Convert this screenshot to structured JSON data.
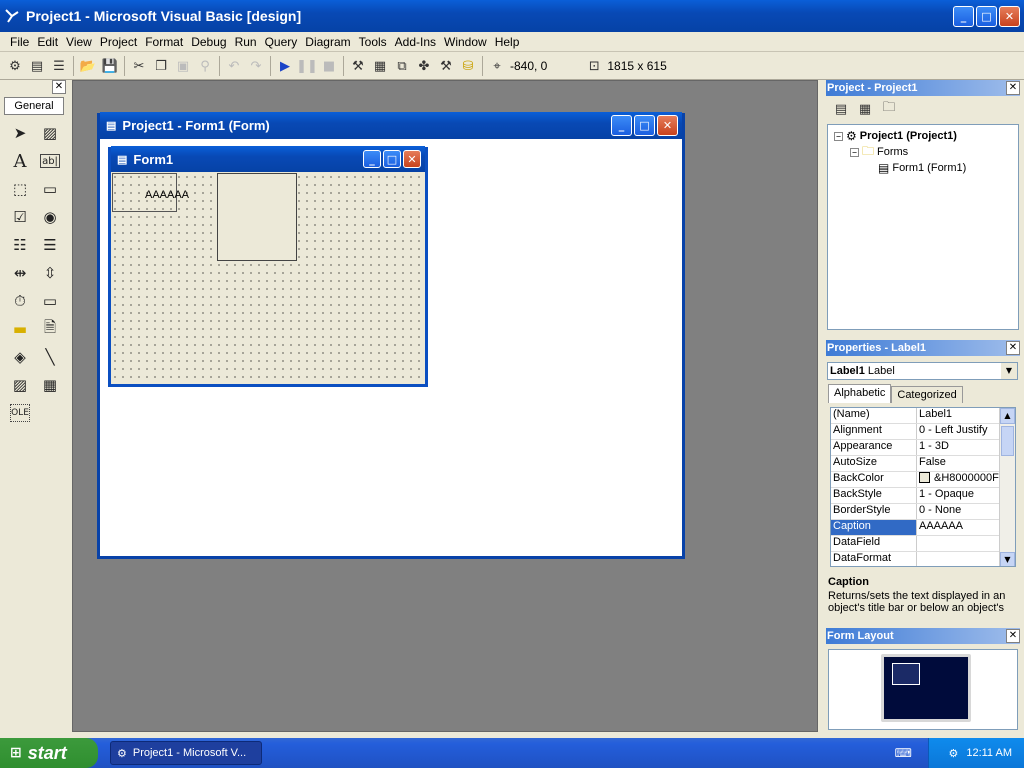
{
  "window": {
    "title": "Project1 - Microsoft Visual Basic [design]"
  },
  "menu": [
    "File",
    "Edit",
    "View",
    "Project",
    "Format",
    "Debug",
    "Run",
    "Query",
    "Diagram",
    "Tools",
    "Add-Ins",
    "Window",
    "Help"
  ],
  "toolbar": {
    "position": "-840, 0",
    "size": "1815 x 615"
  },
  "toolbox": {
    "tab": "General"
  },
  "designer": {
    "title": "Project1 - Form1 (Form)"
  },
  "form": {
    "title": "Form1",
    "label_caption": "AAAAAA"
  },
  "project_panel": {
    "title": "Project - Project1",
    "root": "Project1 (Project1)",
    "folder": "Forms",
    "item": "Form1 (Form1)"
  },
  "properties_panel": {
    "title": "Properties - Label1",
    "object_name": "Label1",
    "object_type": "Label",
    "tabs": [
      "Alphabetic",
      "Categorized"
    ],
    "rows": [
      {
        "k": "(Name)",
        "v": "Label1"
      },
      {
        "k": "Alignment",
        "v": "0 - Left Justify"
      },
      {
        "k": "Appearance",
        "v": "1 - 3D"
      },
      {
        "k": "AutoSize",
        "v": "False"
      },
      {
        "k": "BackColor",
        "v": "&H8000000F"
      },
      {
        "k": "BackStyle",
        "v": "1 - Opaque"
      },
      {
        "k": "BorderStyle",
        "v": "0 - None"
      },
      {
        "k": "Caption",
        "v": "AAAAAA"
      },
      {
        "k": "DataField",
        "v": ""
      },
      {
        "k": "DataFormat",
        "v": ""
      }
    ],
    "selected_index": 7,
    "desc_title": "Caption",
    "desc_text": "Returns/sets the text displayed in an object's title bar or below an object's"
  },
  "layout_panel": {
    "title": "Form Layout"
  },
  "taskbar": {
    "start": "start",
    "task": "Project1 - Microsoft V...",
    "clock": "12:11 AM"
  }
}
